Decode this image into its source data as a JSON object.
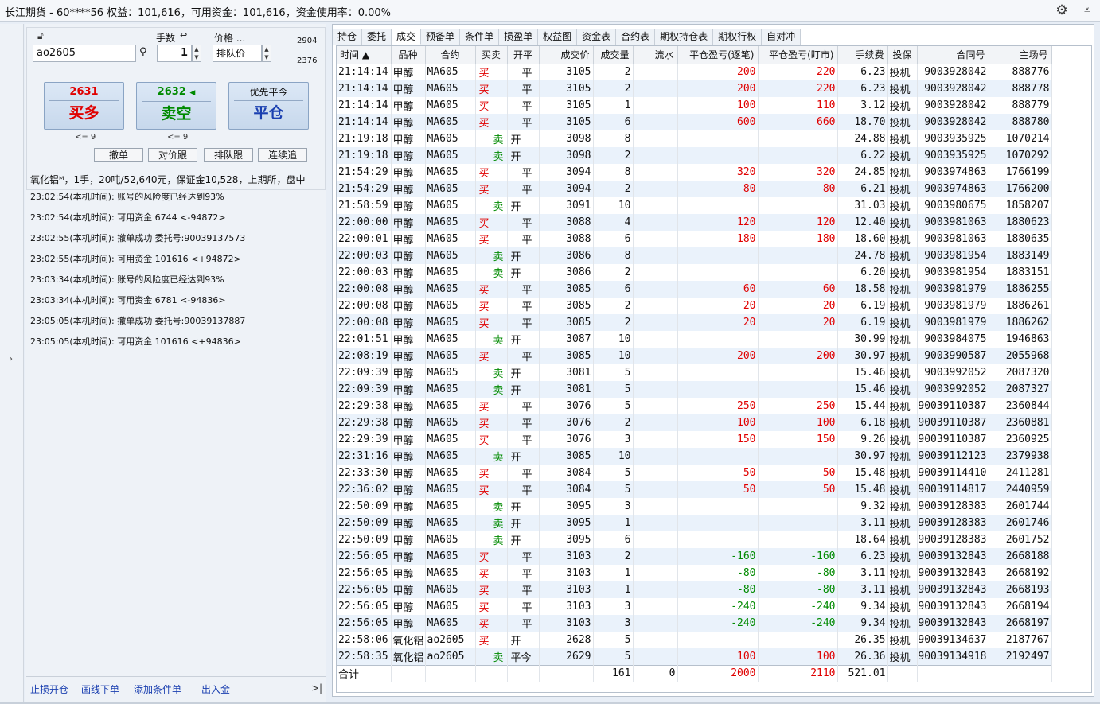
{
  "window": {
    "title": "长江期货 - 60****56  权益：101,616，可用资金：101,616，资金使用率：0.00%"
  },
  "order_panel": {
    "qty_label": "手数",
    "price_label": "价格 ...",
    "price_mode": "排队价",
    "contract_value": "ao2605",
    "qty_value": "1",
    "price_high": "2904",
    "price_low": "2376",
    "buy_price": "2631",
    "buy_label": "买多",
    "sell_price": "2632",
    "sell_label": "卖空",
    "close_top": "优先平今",
    "close_label": "平仓",
    "buy_limit": "<= 9",
    "sell_limit": "<= 9",
    "buttons": [
      "撤单",
      "对价跟",
      "排队跟",
      "连续追"
    ]
  },
  "info_line": "氧化铝ᴹ，1手，20吨/52,640元，保证金10,528，上期所，盘中",
  "logs": [
    "23:02:54(本机时间): 账号的风险度已经达到93%",
    "23:02:54(本机时间): 可用资金 6744 <-94872>",
    "23:02:55(本机时间): 撤单成功 委托号:90039137573",
    "23:02:55(本机时间): 可用资金 101616 <+94872>",
    "23:03:34(本机时间): 账号的风险度已经达到93%",
    "23:03:34(本机时间): 可用资金 6781 <-94836>",
    "23:05:05(本机时间): 撤单成功 委托号:90039137887",
    "23:05:05(本机时间): 可用资金 101616 <+94836>"
  ],
  "left_footer": [
    "止损开仓",
    "画线下单",
    "添加条件单",
    "出入金"
  ],
  "tabs": [
    "持仓",
    "委托",
    "成交",
    "预备单",
    "条件单",
    "损盈单",
    "权益图",
    "资金表",
    "合约表",
    "期权持仓表",
    "期权行权",
    "自对冲"
  ],
  "active_tab": "成交",
  "columns": [
    "时间 ▲",
    "品种",
    "合约",
    "买卖",
    "开平",
    "成交价",
    "成交量",
    "流水",
    "平仓盈亏(逐笔)",
    "平仓盈亏(盯市)",
    "手续费",
    "投保",
    "合同号",
    "主场号"
  ],
  "rows": [
    [
      "21:14:14",
      "甲醇",
      "MA605",
      "买",
      "平",
      "3105",
      "2",
      "",
      "200",
      "220",
      "6.23",
      "投机",
      "9003928042",
      "888776"
    ],
    [
      "21:14:14",
      "甲醇",
      "MA605",
      "买",
      "平",
      "3105",
      "2",
      "",
      "200",
      "220",
      "6.23",
      "投机",
      "9003928042",
      "888778"
    ],
    [
      "21:14:14",
      "甲醇",
      "MA605",
      "买",
      "平",
      "3105",
      "1",
      "",
      "100",
      "110",
      "3.12",
      "投机",
      "9003928042",
      "888779"
    ],
    [
      "21:14:14",
      "甲醇",
      "MA605",
      "买",
      "平",
      "3105",
      "6",
      "",
      "600",
      "660",
      "18.70",
      "投机",
      "9003928042",
      "888780"
    ],
    [
      "21:19:18",
      "甲醇",
      "MA605",
      "卖",
      "开",
      "3098",
      "8",
      "",
      "",
      "",
      "24.88",
      "投机",
      "9003935925",
      "1070214"
    ],
    [
      "21:19:18",
      "甲醇",
      "MA605",
      "卖",
      "开",
      "3098",
      "2",
      "",
      "",
      "",
      "6.22",
      "投机",
      "9003935925",
      "1070292"
    ],
    [
      "21:54:29",
      "甲醇",
      "MA605",
      "买",
      "平",
      "3094",
      "8",
      "",
      "320",
      "320",
      "24.85",
      "投机",
      "9003974863",
      "1766199"
    ],
    [
      "21:54:29",
      "甲醇",
      "MA605",
      "买",
      "平",
      "3094",
      "2",
      "",
      "80",
      "80",
      "6.21",
      "投机",
      "9003974863",
      "1766200"
    ],
    [
      "21:58:59",
      "甲醇",
      "MA605",
      "卖",
      "开",
      "3091",
      "10",
      "",
      "",
      "",
      "31.03",
      "投机",
      "9003980675",
      "1858207"
    ],
    [
      "22:00:00",
      "甲醇",
      "MA605",
      "买",
      "平",
      "3088",
      "4",
      "",
      "120",
      "120",
      "12.40",
      "投机",
      "9003981063",
      "1880623"
    ],
    [
      "22:00:01",
      "甲醇",
      "MA605",
      "买",
      "平",
      "3088",
      "6",
      "",
      "180",
      "180",
      "18.60",
      "投机",
      "9003981063",
      "1880635"
    ],
    [
      "22:00:03",
      "甲醇",
      "MA605",
      "卖",
      "开",
      "3086",
      "8",
      "",
      "",
      "",
      "24.78",
      "投机",
      "9003981954",
      "1883149"
    ],
    [
      "22:00:03",
      "甲醇",
      "MA605",
      "卖",
      "开",
      "3086",
      "2",
      "",
      "",
      "",
      "6.20",
      "投机",
      "9003981954",
      "1883151"
    ],
    [
      "22:00:08",
      "甲醇",
      "MA605",
      "买",
      "平",
      "3085",
      "6",
      "",
      "60",
      "60",
      "18.58",
      "投机",
      "9003981979",
      "1886255"
    ],
    [
      "22:00:08",
      "甲醇",
      "MA605",
      "买",
      "平",
      "3085",
      "2",
      "",
      "20",
      "20",
      "6.19",
      "投机",
      "9003981979",
      "1886261"
    ],
    [
      "22:00:08",
      "甲醇",
      "MA605",
      "买",
      "平",
      "3085",
      "2",
      "",
      "20",
      "20",
      "6.19",
      "投机",
      "9003981979",
      "1886262"
    ],
    [
      "22:01:51",
      "甲醇",
      "MA605",
      "卖",
      "开",
      "3087",
      "10",
      "",
      "",
      "",
      "30.99",
      "投机",
      "9003984075",
      "1946863"
    ],
    [
      "22:08:19",
      "甲醇",
      "MA605",
      "买",
      "平",
      "3085",
      "10",
      "",
      "200",
      "200",
      "30.97",
      "投机",
      "9003990587",
      "2055968"
    ],
    [
      "22:09:39",
      "甲醇",
      "MA605",
      "卖",
      "开",
      "3081",
      "5",
      "",
      "",
      "",
      "15.46",
      "投机",
      "9003992052",
      "2087320"
    ],
    [
      "22:09:39",
      "甲醇",
      "MA605",
      "卖",
      "开",
      "3081",
      "5",
      "",
      "",
      "",
      "15.46",
      "投机",
      "9003992052",
      "2087327"
    ],
    [
      "22:29:38",
      "甲醇",
      "MA605",
      "买",
      "平",
      "3076",
      "5",
      "",
      "250",
      "250",
      "15.44",
      "投机",
      "90039110387",
      "2360844"
    ],
    [
      "22:29:38",
      "甲醇",
      "MA605",
      "买",
      "平",
      "3076",
      "2",
      "",
      "100",
      "100",
      "6.18",
      "投机",
      "90039110387",
      "2360881"
    ],
    [
      "22:29:39",
      "甲醇",
      "MA605",
      "买",
      "平",
      "3076",
      "3",
      "",
      "150",
      "150",
      "9.26",
      "投机",
      "90039110387",
      "2360925"
    ],
    [
      "22:31:16",
      "甲醇",
      "MA605",
      "卖",
      "开",
      "3085",
      "10",
      "",
      "",
      "",
      "30.97",
      "投机",
      "90039112123",
      "2379938"
    ],
    [
      "22:33:30",
      "甲醇",
      "MA605",
      "买",
      "平",
      "3084",
      "5",
      "",
      "50",
      "50",
      "15.48",
      "投机",
      "90039114410",
      "2411281"
    ],
    [
      "22:36:02",
      "甲醇",
      "MA605",
      "买",
      "平",
      "3084",
      "5",
      "",
      "50",
      "50",
      "15.48",
      "投机",
      "90039114817",
      "2440959"
    ],
    [
      "22:50:09",
      "甲醇",
      "MA605",
      "卖",
      "开",
      "3095",
      "3",
      "",
      "",
      "",
      "9.32",
      "投机",
      "90039128383",
      "2601744"
    ],
    [
      "22:50:09",
      "甲醇",
      "MA605",
      "卖",
      "开",
      "3095",
      "1",
      "",
      "",
      "",
      "3.11",
      "投机",
      "90039128383",
      "2601746"
    ],
    [
      "22:50:09",
      "甲醇",
      "MA605",
      "卖",
      "开",
      "3095",
      "6",
      "",
      "",
      "",
      "18.64",
      "投机",
      "90039128383",
      "2601752"
    ],
    [
      "22:56:05",
      "甲醇",
      "MA605",
      "买",
      "平",
      "3103",
      "2",
      "",
      "-160",
      "-160",
      "6.23",
      "投机",
      "90039132843",
      "2668188"
    ],
    [
      "22:56:05",
      "甲醇",
      "MA605",
      "买",
      "平",
      "3103",
      "1",
      "",
      "-80",
      "-80",
      "3.11",
      "投机",
      "90039132843",
      "2668192"
    ],
    [
      "22:56:05",
      "甲醇",
      "MA605",
      "买",
      "平",
      "3103",
      "1",
      "",
      "-80",
      "-80",
      "3.11",
      "投机",
      "90039132843",
      "2668193"
    ],
    [
      "22:56:05",
      "甲醇",
      "MA605",
      "买",
      "平",
      "3103",
      "3",
      "",
      "-240",
      "-240",
      "9.34",
      "投机",
      "90039132843",
      "2668194"
    ],
    [
      "22:56:05",
      "甲醇",
      "MA605",
      "买",
      "平",
      "3103",
      "3",
      "",
      "-240",
      "-240",
      "9.34",
      "投机",
      "90039132843",
      "2668197"
    ],
    [
      "22:58:06",
      "氧化铝",
      "ao2605",
      "买",
      "开",
      "2628",
      "5",
      "",
      "",
      "",
      "26.35",
      "投机",
      "90039134637",
      "2187767"
    ],
    [
      "22:58:35",
      "氧化铝",
      "ao2605",
      "卖",
      "平今",
      "2629",
      "5",
      "",
      "100",
      "100",
      "26.36",
      "投机",
      "90039134918",
      "2192497"
    ]
  ],
  "totals": {
    "label": "合计",
    "volume": "161",
    "flow": "0",
    "pnl_trade": "2000",
    "pnl_mtm": "2110",
    "fee": "521.01"
  },
  "colors": {
    "up": "#e00000",
    "down": "#008a00",
    "link": "#1a3fb0",
    "row_alt": "#eaf2fb"
  }
}
